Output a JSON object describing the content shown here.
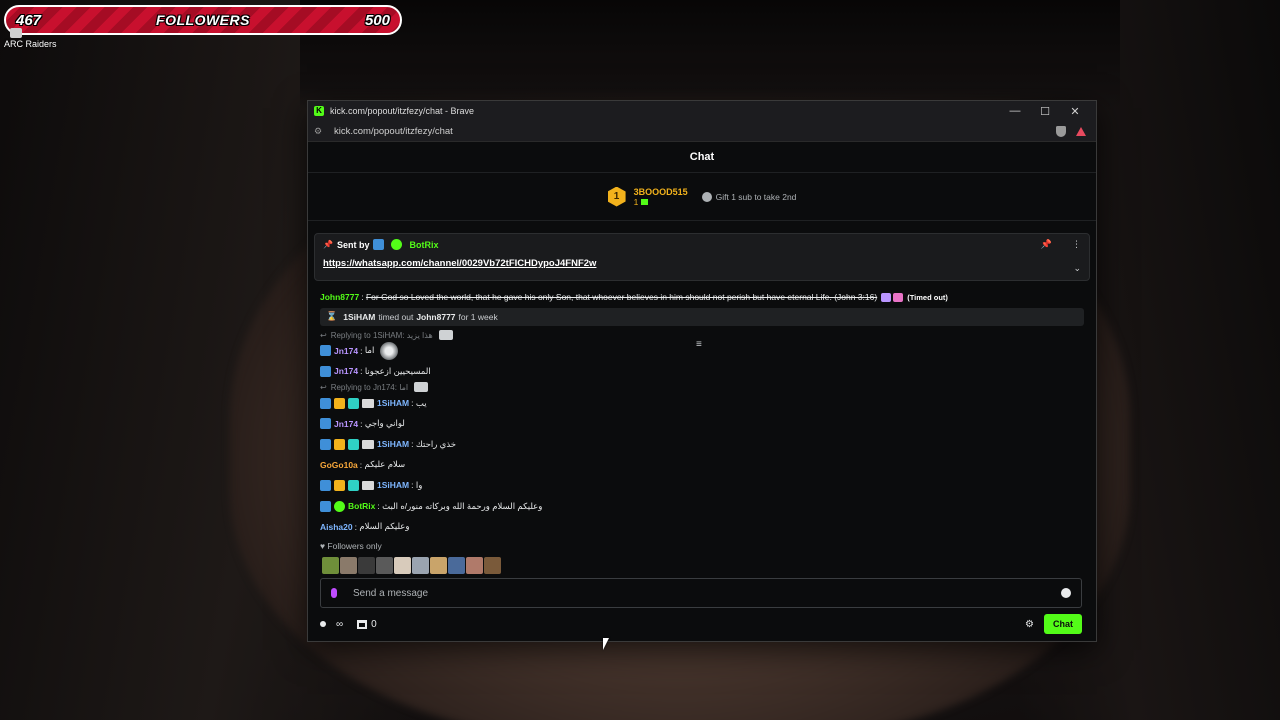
{
  "overlay": {
    "followers_current": "467",
    "followers_label": "FOLLOWERS",
    "followers_goal": "500",
    "goal_progress": 0.934,
    "desktop_icon_label": "ARC Raiders"
  },
  "browser": {
    "title": "kick.com/popout/itzfezy/chat - Brave",
    "url": "kick.com/popout/itzfezy/chat",
    "controls": {
      "minimize": "—",
      "maximize": "☐",
      "close": "✕"
    }
  },
  "chat": {
    "header": "Chat",
    "leaderboard": {
      "rank": "1",
      "user": "3BOOOD515",
      "count": "1",
      "gift_prompt": "Gift 1 sub to take 2nd"
    },
    "pinned": {
      "sent_by_label": "Sent by",
      "sender": "BotRix",
      "link": "https://whatsapp.com/channel/0029Vb72tFICHDypoJ4FNF2w"
    },
    "messages": [
      {
        "user": "John8777",
        "text": "For God so Loved the world, that he gave his only Son, that whoever believes in him should not perish but have eternal Life. (John 3:16)",
        "tag": "(Timed out)"
      },
      {
        "system": true,
        "actor": "1SiHAM",
        "action": "timed out",
        "target": "John8777",
        "duration": "for 1 week"
      },
      {
        "reply_to": "Replying to 1SiHAM: هذا يزيد"
      },
      {
        "user": "Jn174",
        "text": "اما"
      },
      {
        "user": "Jn174",
        "text": "المسيحيين ازعجونا"
      },
      {
        "reply_to": "Replying to Jn174: اما"
      },
      {
        "user": "1SiHAM",
        "text": "يب"
      },
      {
        "user": "Jn174",
        "text": "لواني واجي"
      },
      {
        "user": "1SiHAM",
        "text": "خذي راحتك"
      },
      {
        "user": "GoGo10a",
        "text": "سلام عليكم"
      },
      {
        "user": "1SiHAM",
        "text": "وا"
      },
      {
        "user": "BotRix",
        "text": "وعليكم السلام ورحمة الله وبركاته منور/ه البث"
      },
      {
        "user": "Aisha20",
        "text": "وعليكم السلام"
      }
    ],
    "followers_only": "Followers only",
    "input_placeholder": "Send a message",
    "footer": {
      "infinity": "∞",
      "store_count": "0",
      "chat_button": "Chat"
    }
  }
}
